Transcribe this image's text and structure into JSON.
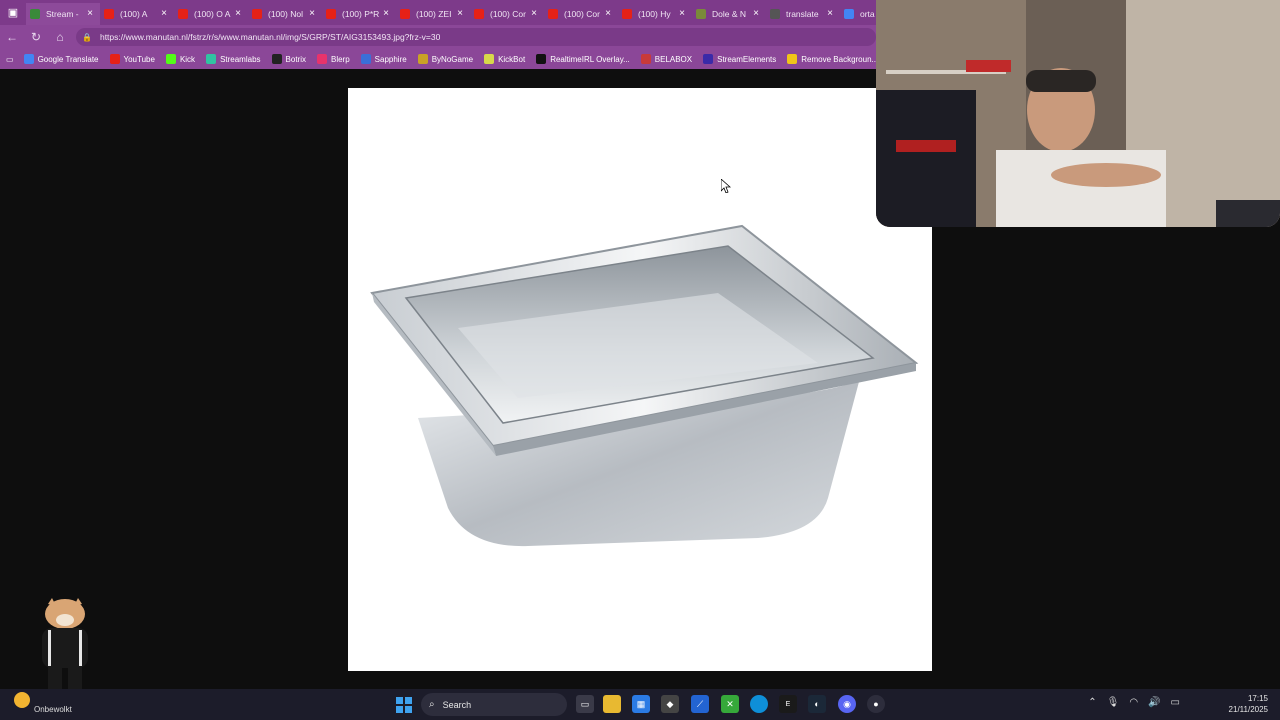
{
  "browser": {
    "tabs": [
      {
        "title": "Stream -",
        "favicon": "kick-icon",
        "color": "#3a8a3a",
        "active": true
      },
      {
        "title": "(100) A",
        "favicon": "youtube-icon",
        "color": "#e62117",
        "active": false
      },
      {
        "title": "(100) O A",
        "favicon": "youtube-icon",
        "color": "#e62117",
        "active": false
      },
      {
        "title": "(100) Nol",
        "favicon": "youtube-icon",
        "color": "#e62117",
        "active": false
      },
      {
        "title": "(100) P*R",
        "favicon": "youtube-icon",
        "color": "#e62117",
        "active": false
      },
      {
        "title": "(100) ZEI",
        "favicon": "youtube-icon",
        "color": "#e62117",
        "active": false
      },
      {
        "title": "(100) Cor",
        "favicon": "youtube-icon",
        "color": "#e62117",
        "active": false
      },
      {
        "title": "(100) Cor",
        "favicon": "youtube-icon",
        "color": "#e62117",
        "active": false
      },
      {
        "title": "(100) Hy",
        "favicon": "youtube-icon",
        "color": "#e62117",
        "active": false
      },
      {
        "title": "Dole & N",
        "favicon": "web-icon",
        "color": "#7a8a3a",
        "active": false
      },
      {
        "title": "translate",
        "favicon": "globe-icon",
        "color": "#555555",
        "active": false
      },
      {
        "title": "orta",
        "favicon": "google-icon",
        "color": "#4285f4",
        "active": false
      }
    ],
    "url": "https://www.manutan.nl/fstrz/r/s/www.manutan.nl/img/S/GRP/ST/AIG3153493.jpg?frz-v=30",
    "bookmarks": [
      {
        "label": "Google Translate",
        "icon": "translate-icon",
        "color": "#4285f4"
      },
      {
        "label": "YouTube",
        "icon": "youtube-icon",
        "color": "#e62117"
      },
      {
        "label": "Kick",
        "icon": "kick-icon",
        "color": "#53fc18"
      },
      {
        "label": "Streamlabs",
        "icon": "streamlabs-icon",
        "color": "#31c3a2"
      },
      {
        "label": "Botrix",
        "icon": "botrix-icon",
        "color": "#222222"
      },
      {
        "label": "Blerp",
        "icon": "blerp-icon",
        "color": "#e8336b"
      },
      {
        "label": "Sapphire",
        "icon": "sapphire-icon",
        "color": "#3a6fd8"
      },
      {
        "label": "ByNoGame",
        "icon": "bynogame-icon",
        "color": "#c9a227"
      },
      {
        "label": "KickBot",
        "icon": "kickbot-icon",
        "color": "#d8d84a"
      },
      {
        "label": "RealtimeIRL Overlay...",
        "icon": "rtirl-icon",
        "color": "#111111"
      },
      {
        "label": "BELABOX",
        "icon": "belabox-icon",
        "color": "#c83a3a"
      },
      {
        "label": "StreamElements",
        "icon": "streamelements-icon",
        "color": "#3a2aa8"
      },
      {
        "label": "Remove Backgroun...",
        "icon": "removebg-icon",
        "color": "#f0c419"
      }
    ]
  },
  "taskbar": {
    "weather_label": "Onbewolkt",
    "search_label": "Search",
    "time": "17:15",
    "date": "21/11/2025"
  }
}
